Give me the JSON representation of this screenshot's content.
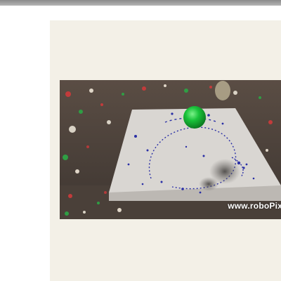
{
  "document": {
    "video": {
      "watermark": "www.roboPix"
    }
  },
  "colors": {
    "panel_background": "#f3f0e7",
    "canvas_board": "#d9d6d2",
    "ball": "#19c23a",
    "paint_splatter": "#2a2fa6"
  }
}
